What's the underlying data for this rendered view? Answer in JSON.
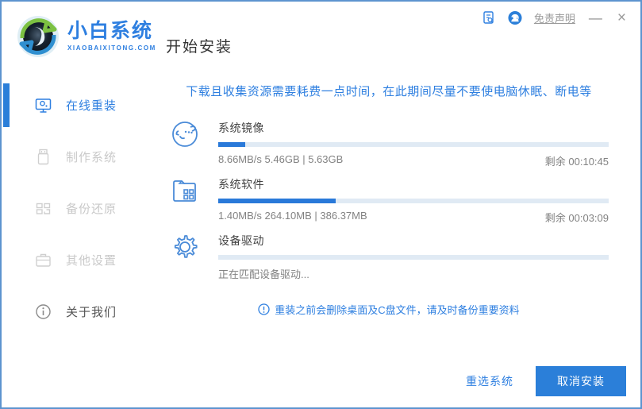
{
  "window": {
    "brand_name": "小白系统",
    "brand_domain": "XIAOBAIXITONG.COM",
    "page_title": "开始安装",
    "titlebar": {
      "disclaimer": "免责声明",
      "minimize": "—",
      "close": "×"
    }
  },
  "sidebar": {
    "items": [
      {
        "label": "在线重装",
        "state": "active"
      },
      {
        "label": "制作系统",
        "state": "disabled"
      },
      {
        "label": "备份还原",
        "state": "disabled"
      },
      {
        "label": "其他设置",
        "state": "disabled"
      },
      {
        "label": "关于我们",
        "state": "normal"
      }
    ]
  },
  "main": {
    "warning": "下载且收集资源需要耗费一点时间，在此期间尽量不要使电脑休眠、断电等",
    "tasks": [
      {
        "name": "系统镜像",
        "progress_percent": 7,
        "status_left": "8.66MB/s 5.46GB | 5.63GB",
        "status_right": "剩余 00:10:45"
      },
      {
        "name": "系统软件",
        "progress_percent": 30,
        "status_left": "1.40MB/s 264.10MB | 386.37MB",
        "status_right": "剩余 00:03:09"
      },
      {
        "name": "设备驱动",
        "progress_percent": 0,
        "status_left": "正在匹配设备驱动...",
        "status_right": ""
      }
    ],
    "note": "重装之前会删除桌面及C盘文件，请及时备份重要资料"
  },
  "footer": {
    "reselect_label": "重选系统",
    "cancel_label": "取消安装"
  },
  "colors": {
    "accent_blue": "#2e7fe0",
    "progress_fill": "#2979d9",
    "progress_track": "#e0eaf4",
    "window_border": "#5d94cf",
    "disabled_gray": "#c9c9c9",
    "status_gray": "#828282"
  }
}
